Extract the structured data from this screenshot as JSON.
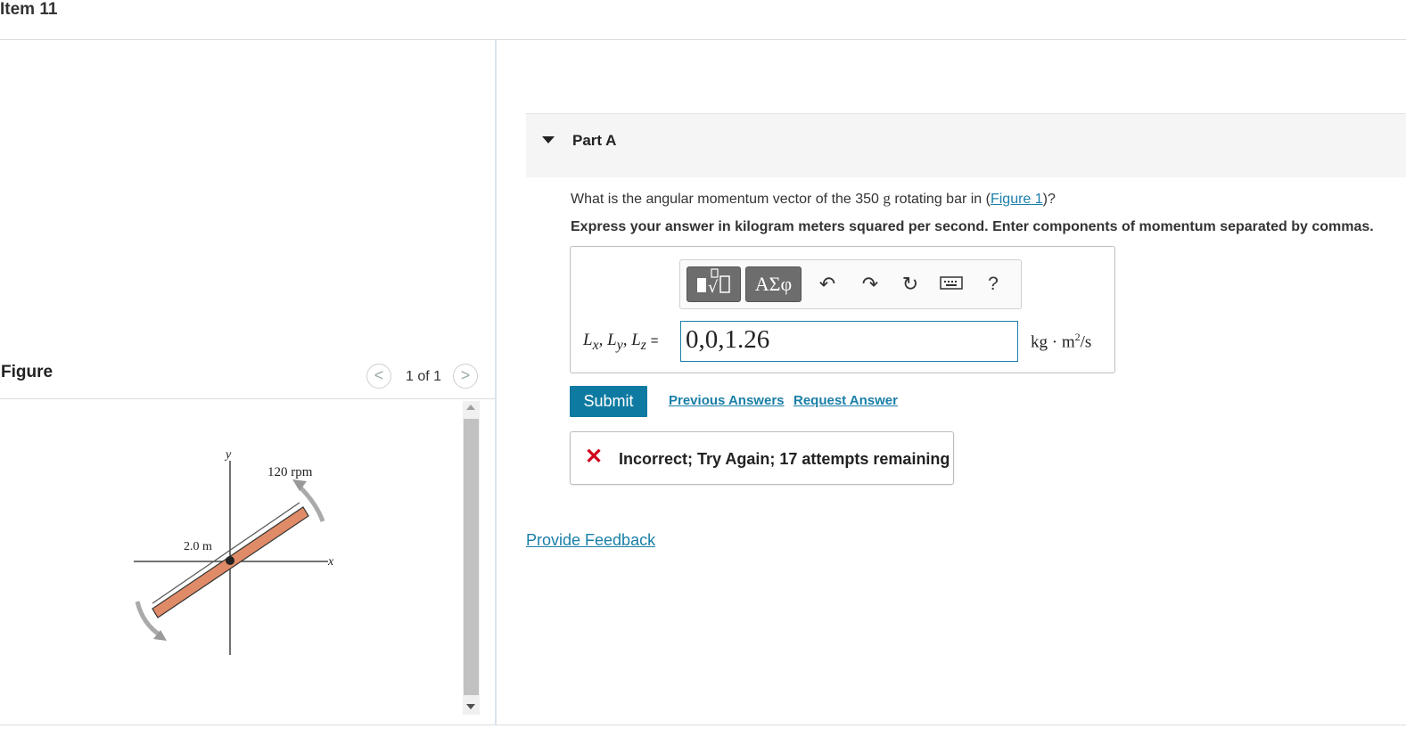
{
  "item": {
    "title": "Item 11"
  },
  "figure": {
    "label": "Figure",
    "counter": "1 of 1",
    "prev_glyph": "<",
    "next_glyph": ">",
    "axis_y": "y",
    "axis_x": "x",
    "length_label": "2.0 m",
    "speed_label": "120 rpm",
    "bar_color": "#e08b68"
  },
  "part": {
    "title": "Part A",
    "question_prefix": "What is the angular momentum vector of the 350 ",
    "question_unit": "g",
    "question_mid": " rotating bar in (",
    "question_link": "Figure 1",
    "question_suffix": ")?",
    "instruction": "Express your answer in kilogram meters squared per second. Enter components of momentum separated by commas."
  },
  "answer": {
    "toolbar": {
      "templates_icon": "templates-icon",
      "greek_label": "ΑΣφ",
      "undo_icon": "undo-icon",
      "redo_icon": "redo-icon",
      "reset_icon": "reset-icon",
      "keyboard_icon": "keyboard-icon",
      "help_label": "?"
    },
    "lhs": {
      "lx": "L",
      "lx_sub": "x",
      "ly": "L",
      "ly_sub": "y",
      "lz": "L",
      "lz_sub": "z",
      "eq": "="
    },
    "value": "0,0,1.26",
    "units_pre": "kg · m",
    "units_exp": "2",
    "units_post": "/s"
  },
  "actions": {
    "submit": "Submit",
    "previous_answers": "Previous Answers",
    "request_answer": "Request Answer"
  },
  "feedback": {
    "status_icon": "incorrect-x-icon",
    "status_color": "#d0021b",
    "message": "Incorrect; Try Again; 17 attempts remaining"
  },
  "footer": {
    "provide_feedback": "Provide Feedback"
  },
  "colors": {
    "accent": "#0e7aa1",
    "link": "#1a7fa8"
  }
}
